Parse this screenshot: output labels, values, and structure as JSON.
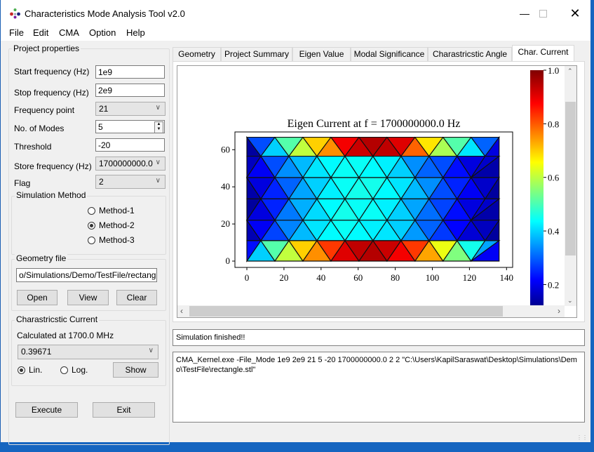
{
  "window": {
    "title": "Characteristics Mode Analysis Tool v2.0",
    "minimize_icon": "minimize-icon",
    "maximize_icon": "maximize-icon",
    "close_icon": "close-icon"
  },
  "menu": [
    "File",
    "Edit",
    "CMA",
    "Option",
    "Help"
  ],
  "project_properties": {
    "title": "Project properties",
    "start_frequency": {
      "label": "Start frequency (Hz)",
      "value": "1e9"
    },
    "stop_frequency": {
      "label": "Stop frequency (Hz)",
      "value": "2e9"
    },
    "frequency_point": {
      "label": "Frequency point",
      "value": "21"
    },
    "modes": {
      "label": "No. of Modes",
      "value": "5"
    },
    "threshold": {
      "label": "Threshold",
      "value": "-20"
    },
    "store_frequency": {
      "label": "Store frequency (Hz)",
      "value": "1700000000.0"
    },
    "flag": {
      "label": "Flag",
      "value": "2"
    },
    "simulation_method": {
      "title": "Simulation Method",
      "options": [
        "Method-1",
        "Method-2",
        "Method-3"
      ],
      "selected": "Method-2"
    },
    "geometry_file": {
      "title": "Geometry file",
      "path": "o/Simulations/Demo/TestFile/rectangle.stl",
      "open": "Open",
      "view": "View",
      "clear": "Clear"
    }
  },
  "char_current": {
    "title": "Charastricstic Current",
    "calculated_at": "Calculated at 1700.0 MHz",
    "selected_value": "0.39671",
    "scale_options": [
      "Lin.",
      "Log."
    ],
    "scale_selected": "Lin.",
    "show": "Show"
  },
  "actions": {
    "execute": "Execute",
    "exit": "Exit"
  },
  "tabs": [
    "Geometry",
    "Project Summary",
    "Eigen Value",
    "Modal Significance",
    "Charastricstic Angle",
    "Char. Current"
  ],
  "active_tab": "Char. Current",
  "status": "Simulation finished!!",
  "log": "CMA_Kernel.exe -File_Mode 1e9 2e9 21 5 -20 1700000000.0 2 2 \"C:\\Users\\KapilSaraswat\\Desktop\\Simulations\\Demo\\TestFile\\rectangle.stl\"",
  "chart_data": {
    "type": "heatmap",
    "subtype": "triangular-mesh",
    "title": "Eigen Current at f = 1700000000.0 Hz",
    "xlabel": "",
    "ylabel": "",
    "xlim": [
      -3,
      142
    ],
    "ylim": [
      -3,
      70
    ],
    "xticks": [
      0,
      20,
      40,
      60,
      80,
      100,
      120,
      140
    ],
    "yticks": [
      0,
      20,
      40,
      60
    ],
    "colorbar": {
      "range": [
        0.12,
        1.0
      ],
      "ticks": [
        "1.0",
        "0.8",
        "0.6",
        "0.4",
        "0.2"
      ],
      "tick_values": [
        1.0,
        0.8,
        0.6,
        0.4,
        0.2
      ],
      "colormap": "jet",
      "placement": "right"
    },
    "mesh": {
      "width": 136,
      "height": 66.7,
      "row_y": [
        66.7,
        56.5,
        45,
        33.5,
        22,
        11,
        0
      ],
      "strip_values": [
        [
          0.12,
          0.28,
          0.4,
          0.52,
          0.62,
          0.72,
          0.78,
          0.92,
          0.96,
          0.98,
          0.97,
          0.94,
          0.82,
          0.7,
          0.6,
          0.52,
          0.42,
          0.3,
          0.18
        ],
        [
          0.15,
          0.2,
          0.28,
          0.34,
          0.38,
          0.42,
          0.44,
          0.45,
          0.45,
          0.44,
          0.43,
          0.4,
          0.34,
          0.3,
          0.28,
          0.22,
          0.18,
          0.16,
          0.13
        ],
        [
          0.13,
          0.18,
          0.24,
          0.3,
          0.36,
          0.4,
          0.43,
          0.45,
          0.46,
          0.46,
          0.44,
          0.42,
          0.38,
          0.34,
          0.28,
          0.24,
          0.2,
          0.16,
          0.12
        ],
        [
          0.12,
          0.18,
          0.24,
          0.32,
          0.37,
          0.41,
          0.44,
          0.46,
          0.45,
          0.45,
          0.43,
          0.4,
          0.36,
          0.31,
          0.27,
          0.22,
          0.18,
          0.16,
          0.13
        ],
        [
          0.14,
          0.2,
          0.27,
          0.33,
          0.38,
          0.42,
          0.44,
          0.45,
          0.44,
          0.43,
          0.42,
          0.4,
          0.35,
          0.3,
          0.26,
          0.21,
          0.17,
          0.15,
          0.12
        ],
        [
          0.22,
          0.4,
          0.52,
          0.62,
          0.72,
          0.78,
          0.86,
          0.94,
          0.97,
          0.98,
          0.96,
          0.92,
          0.86,
          0.76,
          0.66,
          0.56,
          0.46,
          0.36,
          0.2
        ]
      ]
    }
  }
}
